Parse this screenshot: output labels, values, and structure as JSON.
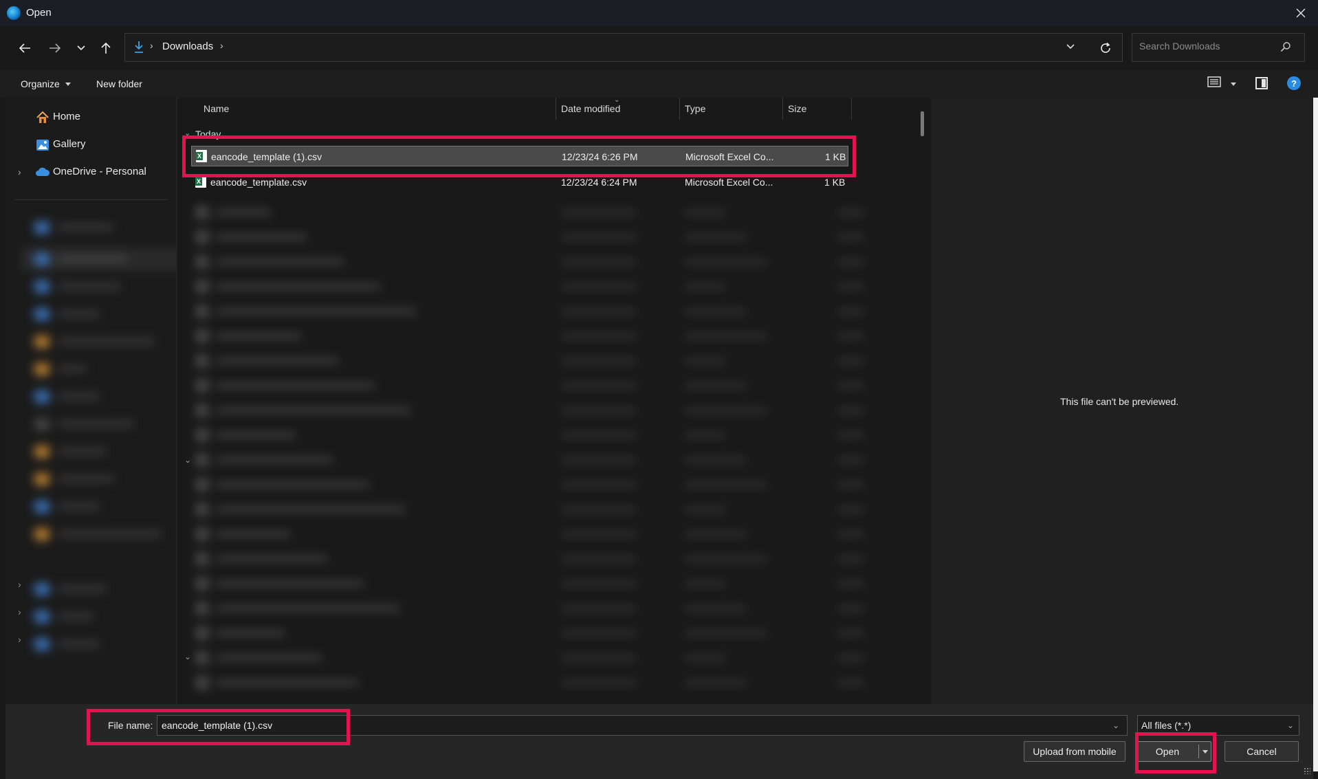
{
  "window": {
    "title": "Open"
  },
  "address": {
    "breadcrumb": [
      "Downloads"
    ],
    "search_placeholder": "Search Downloads"
  },
  "toolbar": {
    "organize_label": "Organize",
    "new_folder_label": "New folder"
  },
  "nav": {
    "items": [
      {
        "label": "Home",
        "icon": "home-icon"
      },
      {
        "label": "Gallery",
        "icon": "gallery-icon"
      },
      {
        "label": "OneDrive - Personal",
        "icon": "onedrive-cloud-icon"
      }
    ]
  },
  "list": {
    "columns": [
      "Name",
      "Date modified",
      "Type",
      "Size"
    ],
    "group": "Today",
    "rows": [
      {
        "name": "eancode_template (1).csv",
        "date": "12/23/24 6:26 PM",
        "type": "Microsoft Excel Co...",
        "size": "1 KB",
        "selected": true
      },
      {
        "name": "eancode_template.csv",
        "date": "12/23/24 6:24 PM",
        "type": "Microsoft Excel Co...",
        "size": "1 KB",
        "selected": false
      }
    ]
  },
  "preview": {
    "message": "This file can't be previewed."
  },
  "footer": {
    "filename_label": "File name:",
    "filename_value": "eancode_template (1).csv",
    "filetype_value": "All files (*.*)",
    "upload_label": "Upload from mobile",
    "open_label": "Open",
    "cancel_label": "Cancel"
  },
  "colors": {
    "highlight": "#e3134f",
    "accent": "#2a8be0"
  }
}
